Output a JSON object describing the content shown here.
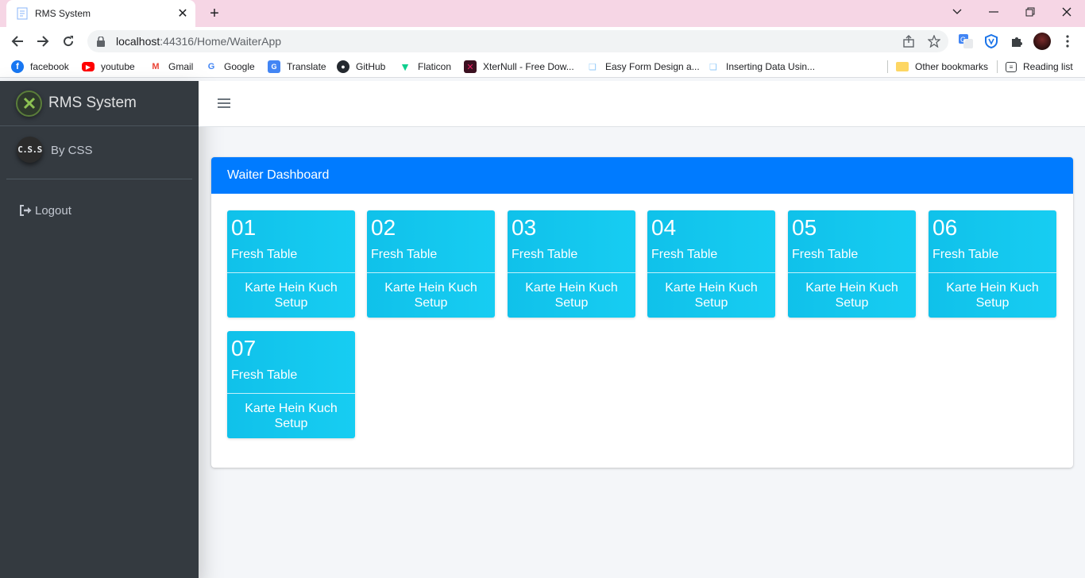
{
  "browser": {
    "tab_title": "RMS System",
    "new_tab_icon": "plus-icon",
    "url_host": "localhost",
    "url_path": ":44316/Home/WaiterApp",
    "bookmarks": [
      {
        "label": "facebook",
        "icon": "facebook-icon",
        "color": "#1877f2"
      },
      {
        "label": "youtube",
        "icon": "youtube-icon",
        "color": "#ff0000"
      },
      {
        "label": "Gmail",
        "icon": "gmail-icon",
        "color": "#ea4335"
      },
      {
        "label": "Google",
        "icon": "google-icon",
        "color": "#4285f4"
      },
      {
        "label": "Translate",
        "icon": "translate-icon",
        "color": "#4285f4"
      },
      {
        "label": "GitHub",
        "icon": "github-icon",
        "color": "#24292f"
      },
      {
        "label": "Flaticon",
        "icon": "flaticon-icon",
        "color": "#0fcf8e"
      },
      {
        "label": "XterNull - Free Dow...",
        "icon": "xternull-icon",
        "color": "#c2185b"
      },
      {
        "label": "Easy Form Design a...",
        "icon": "page-icon",
        "color": "#90caf9"
      },
      {
        "label": "Inserting Data Usin...",
        "icon": "page-icon",
        "color": "#90caf9"
      }
    ],
    "other_bookmarks": "Other bookmarks",
    "reading_list": "Reading list"
  },
  "sidebar": {
    "brand": "RMS System",
    "user_avatar_text": "C.S.S",
    "user_name": "By CSS",
    "nav": [
      {
        "label": "Logout",
        "icon": "sign-out-icon"
      }
    ]
  },
  "dashboard": {
    "title": "Waiter Dashboard",
    "tables": [
      {
        "number": "01",
        "status": "Fresh Table",
        "action": "Karte Hein Kuch Setup"
      },
      {
        "number": "02",
        "status": "Fresh Table",
        "action": "Karte Hein Kuch Setup"
      },
      {
        "number": "03",
        "status": "Fresh Table",
        "action": "Karte Hein Kuch Setup"
      },
      {
        "number": "04",
        "status": "Fresh Table",
        "action": "Karte Hein Kuch Setup"
      },
      {
        "number": "05",
        "status": "Fresh Table",
        "action": "Karte Hein Kuch Setup"
      },
      {
        "number": "06",
        "status": "Fresh Table",
        "action": "Karte Hein Kuch Setup"
      },
      {
        "number": "07",
        "status": "Fresh Table",
        "action": "Karte Hein Kuch Setup"
      }
    ]
  },
  "colors": {
    "sidebar_bg": "#343a40",
    "header_blue": "#007bff",
    "tile_cyan": "#17c5ee",
    "tab_strip": "#f6d6e5"
  }
}
